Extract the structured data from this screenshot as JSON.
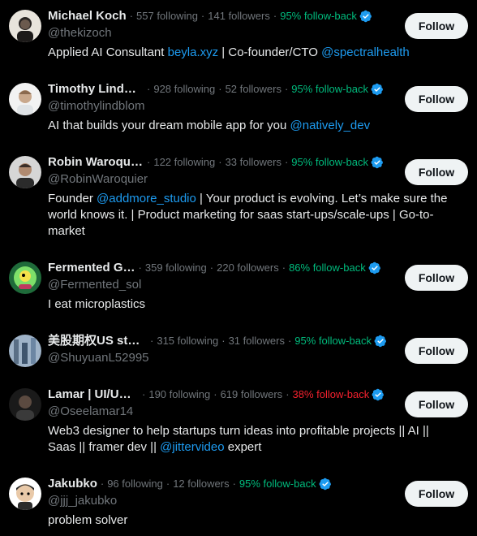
{
  "follow_label": "Follow",
  "colors": {
    "background": "#000000",
    "text": "#e7e9ea",
    "muted": "#71767b",
    "link": "#1d9bf0",
    "followback_good": "#00ba7c",
    "followback_bad": "#f4212e",
    "verified": "#1d9bf0",
    "button_bg": "#eff3f4"
  },
  "users": [
    {
      "name": "Michael Koch",
      "following": "557 following",
      "followers": "141 followers",
      "followback": "95% follow-back",
      "followback_status": "good",
      "verified": true,
      "handle": "@thekizoch",
      "bio": [
        {
          "text": "Applied AI Consultant "
        },
        {
          "text": "beyla.xyz",
          "link": true
        },
        {
          "text": " | Co-founder/CTO "
        },
        {
          "text": "@spectralhealth",
          "link": true
        }
      ]
    },
    {
      "name": "Timothy Lindbl…",
      "following": "928 following",
      "followers": "52 followers",
      "followback": "95% follow-back",
      "followback_status": "good",
      "verified": true,
      "handle": "@timothylindblom",
      "bio": [
        {
          "text": "AI that builds your dream mobile app for you "
        },
        {
          "text": "@natively_dev",
          "link": true
        }
      ]
    },
    {
      "name": "Robin Waroqui…",
      "following": "122 following",
      "followers": "33 followers",
      "followback": "95% follow-back",
      "followback_status": "good",
      "verified": true,
      "handle": "@RobinWaroquier",
      "bio": [
        {
          "text": "Founder "
        },
        {
          "text": "@addmore_studio",
          "link": true
        },
        {
          "text": " | Your product is evolving. Let’s make sure the world knows it. | Product marketing for saas start-ups/scale-ups | Go-to-market"
        }
      ]
    },
    {
      "name": "Fermented G…",
      "following": "359 following",
      "followers": "220 followers",
      "followback": "86% follow-back",
      "followback_status": "good",
      "verified": true,
      "handle": "@Fermented_sol",
      "bio": [
        {
          "text": "I eat microplastics"
        }
      ]
    },
    {
      "name": "美股期权US sto…",
      "following": "315 following",
      "followers": "31 followers",
      "followback": "95% follow-back",
      "followback_status": "good",
      "verified": true,
      "handle": "@ShuyuanL52995",
      "bio": []
    },
    {
      "name": "Lamar | UI/UX…",
      "following": "190 following",
      "followers": "619 followers",
      "followback": "38% follow-back",
      "followback_status": "bad",
      "verified": true,
      "handle": "@Oseelamar14",
      "bio": [
        {
          "text": "Web3 designer to help startups turn ideas into profitable projects || AI || Saas || framer dev || "
        },
        {
          "text": "@jittervideo",
          "link": true
        },
        {
          "text": " expert"
        }
      ]
    },
    {
      "name": "Jakubko",
      "following": "96 following",
      "followers": "12 followers",
      "followback": "95% follow-back",
      "followback_status": "good",
      "verified": true,
      "handle": "@jjj_jakubko",
      "bio": [
        {
          "text": "problem solver"
        }
      ]
    }
  ]
}
